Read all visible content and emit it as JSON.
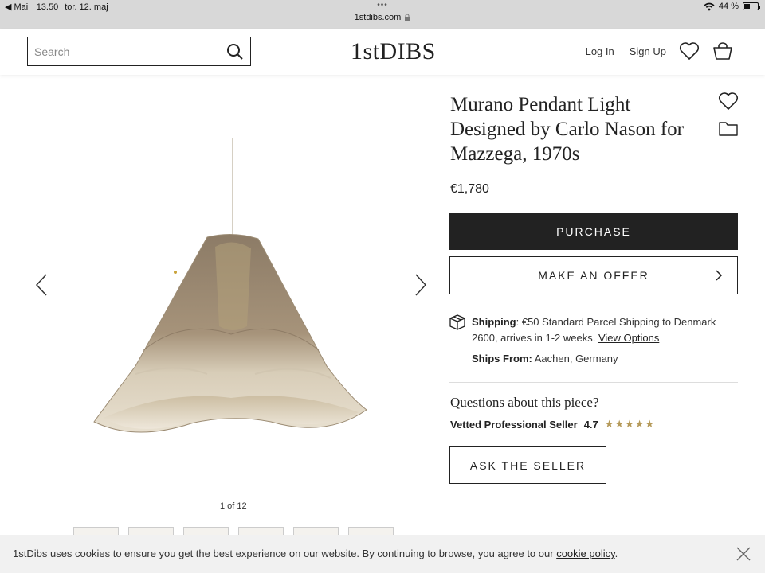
{
  "status_bar": {
    "back_app": "Mail",
    "time": "13.50",
    "date": "tor. 12. maj",
    "url": "1stdibs.com",
    "battery": "44 %",
    "battery_level": 0.44
  },
  "header": {
    "search_placeholder": "Search",
    "logo": "1stDIBS",
    "login": "Log In",
    "signup": "Sign Up"
  },
  "gallery": {
    "counter": "1 of 12",
    "thumbnail_count": 6
  },
  "product": {
    "title": "Murano Pendant Light Designed by Carlo Nason for Mazzega, 1970s",
    "price": "€1,780",
    "purchase_label": "PURCHASE",
    "offer_label": "MAKE AN OFFER",
    "shipping_label": "Shipping",
    "shipping_text": ": €50 Standard Parcel Shipping to Denmark 2600, arrives in 1-2 weeks. ",
    "view_options": "View Options",
    "ships_from_label": "Ships From:",
    "ships_from_value": "Aachen, Germany"
  },
  "seller": {
    "questions": "Questions about this piece?",
    "name": "Vetted Professional Seller",
    "rating": "4.7",
    "stars": "★★★★★",
    "ask_label": "ASK THE SELLER"
  },
  "cookie": {
    "text": "1stDibs uses cookies to ensure you get the best experience on our website. By continuing to browse, you agree to our ",
    "link": "cookie policy",
    "end": "."
  },
  "colors": {
    "dark": "#222222",
    "star": "#b59a5a",
    "status_bar": "#d8d8d8"
  }
}
